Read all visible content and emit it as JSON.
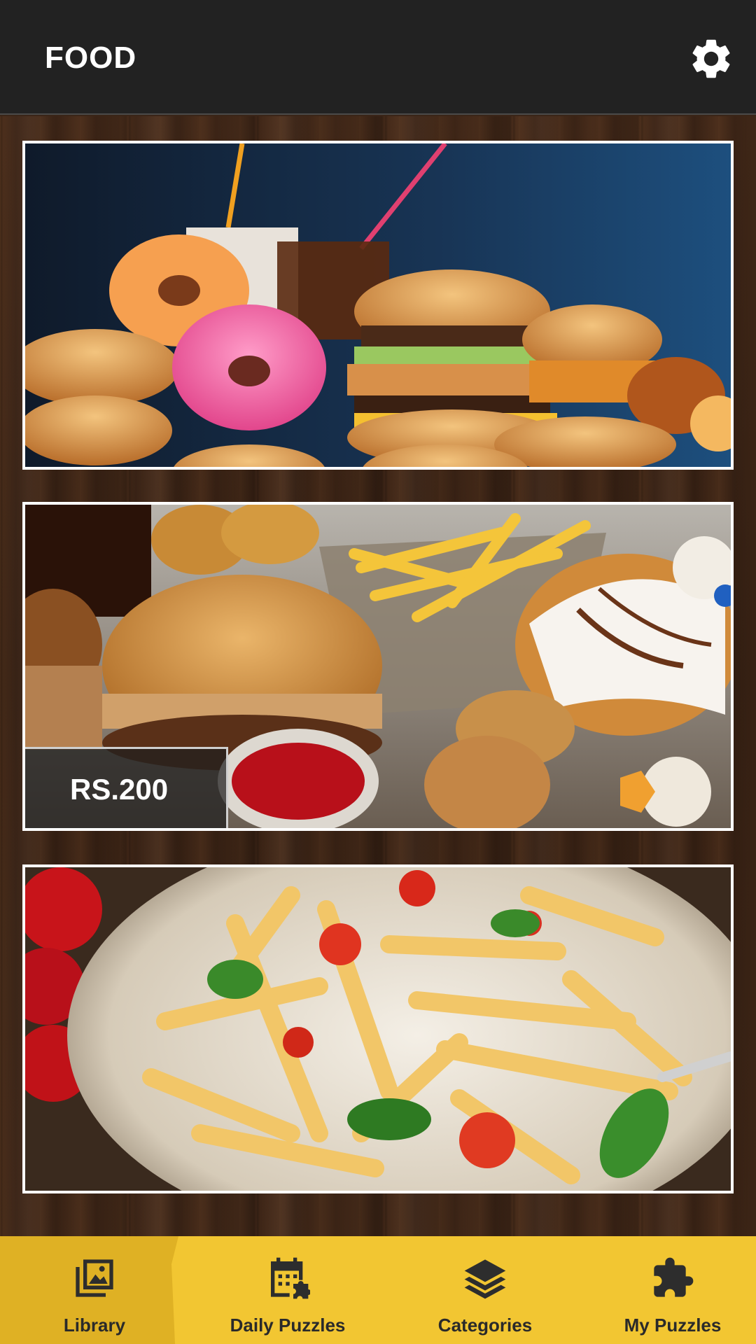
{
  "header": {
    "title": "FOOD",
    "settings_icon": "gear-icon"
  },
  "puzzles": [
    {
      "id": "fast-food-burgers-donuts",
      "price": null
    },
    {
      "id": "burger-fries-donut",
      "price": "RS.200"
    },
    {
      "id": "pasta-plate",
      "price": null
    }
  ],
  "bottom_nav": {
    "active": "library",
    "items": [
      {
        "key": "library",
        "label": "Library",
        "icon": "library-images-icon"
      },
      {
        "key": "daily",
        "label": "Daily Puzzles",
        "icon": "calendar-puzzle-icon"
      },
      {
        "key": "categories",
        "label": "Categories",
        "icon": "layers-icon"
      },
      {
        "key": "my",
        "label": "My Puzzles",
        "icon": "puzzle-piece-icon"
      }
    ]
  },
  "colors": {
    "header_bg": "#222222",
    "nav_bg": "#f2c632",
    "nav_active_bg": "#dfb124",
    "card_border": "#ffffff"
  }
}
